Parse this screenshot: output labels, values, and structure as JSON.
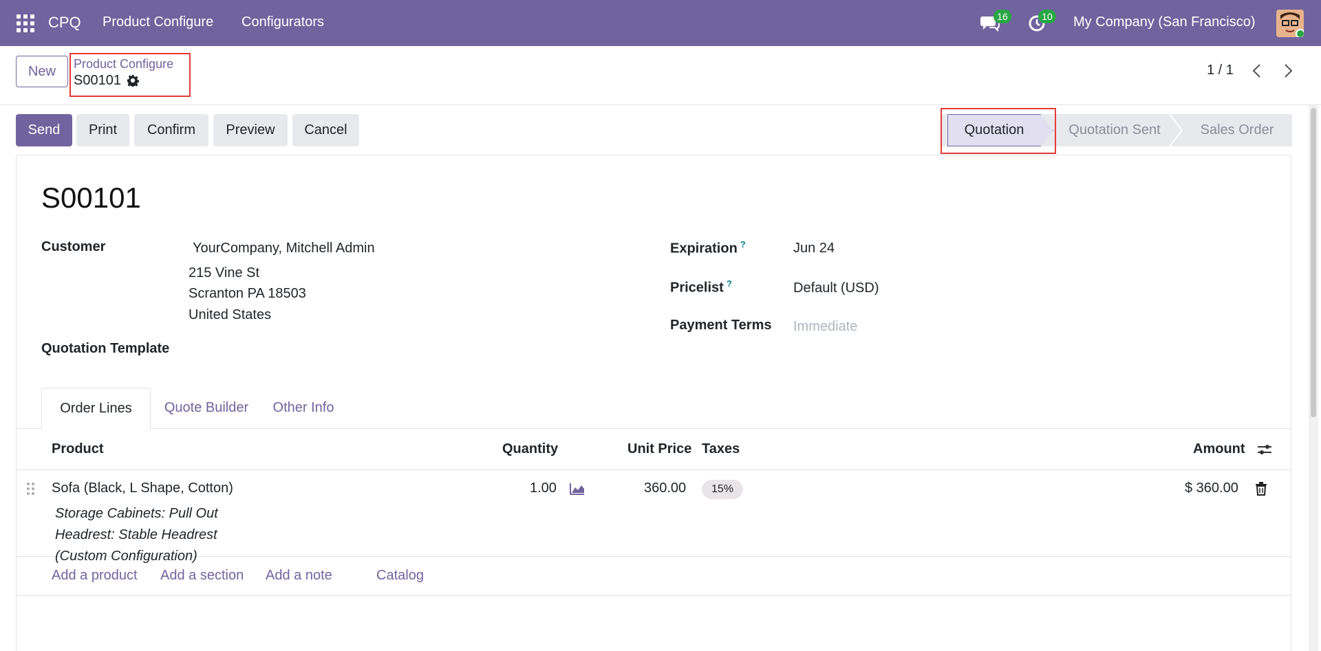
{
  "navbar": {
    "brand": "CPQ",
    "menu": [
      "Product Configure",
      "Configurators"
    ],
    "messages_count": "16",
    "activities_count": "10",
    "company": "My Company (San Francisco)"
  },
  "control_panel": {
    "new_label": "New",
    "breadcrumb_parent": "Product Configure",
    "breadcrumb_current": "S00101",
    "pager": "1 / 1"
  },
  "actions": {
    "send": "Send",
    "print": "Print",
    "confirm": "Confirm",
    "preview": "Preview",
    "cancel": "Cancel"
  },
  "stages": [
    "Quotation",
    "Quotation Sent",
    "Sales Order"
  ],
  "record": {
    "name": "S00101",
    "customer_label": "Customer",
    "customer_name": "YourCompany, Mitchell Admin",
    "address_line1": "215 Vine St",
    "address_line2": "Scranton PA 18503",
    "address_line3": "United States",
    "quotation_template_label": "Quotation Template",
    "expiration_label": "Expiration",
    "expiration_value": "Jun 24",
    "pricelist_label": "Pricelist",
    "pricelist_value": "Default (USD)",
    "payment_terms_label": "Payment Terms",
    "payment_terms_placeholder": "Immediate"
  },
  "tabs": [
    "Order Lines",
    "Quote Builder",
    "Other Info"
  ],
  "table": {
    "headers": {
      "product": "Product",
      "quantity": "Quantity",
      "unit_price": "Unit Price",
      "taxes": "Taxes",
      "amount": "Amount"
    },
    "rows": [
      {
        "product": "Sofa (Black, L Shape, Cotton)",
        "description": [
          "Storage Cabinets: Pull Out",
          "Headrest: Stable Headrest",
          "(Custom Configuration)"
        ],
        "quantity": "1.00",
        "unit_price": "360.00",
        "tax": "15%",
        "amount": "$ 360.00"
      }
    ],
    "add_links": {
      "add_product": "Add a product",
      "add_section": "Add a section",
      "add_note": "Add a note",
      "catalog": "Catalog"
    }
  },
  "colors": {
    "brand": "#71639e",
    "badge": "#28a745",
    "highlight": "#e53935"
  }
}
